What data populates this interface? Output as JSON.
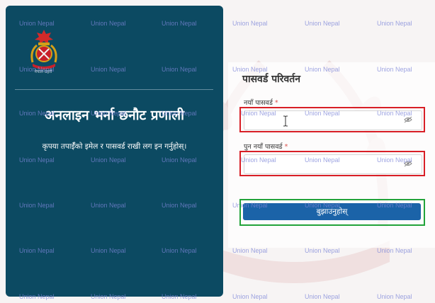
{
  "brand": {
    "logo_caption": "नेपाल प्रहरी",
    "title": "अनलाइन भर्ना छनौट प्रणाली",
    "subtitle": "कृपया तपाईँको इमेल र पासवर्ड राखी लग इन गर्नुहोस्।"
  },
  "form": {
    "heading": "पासवर्ड परिवर्तन",
    "new_password_label": "नयाँ पासवर्ड",
    "new_password_required": "*",
    "new_password_value": "",
    "confirm_password_label": "पुन नयाँ पासवर्ड",
    "confirm_password_required": "*",
    "confirm_password_value": "",
    "submit_label": "बुझाउनुहोस्"
  },
  "watermark": {
    "text": "Union Nepal"
  },
  "colors": {
    "panel": "#0c4a62",
    "button": "#1b63a8",
    "required": "#d9534f",
    "highlight_red": "#d81f26",
    "highlight_green": "#22a33a"
  },
  "icons": {
    "new_password_toggle": "eye-slash-icon",
    "confirm_password_toggle": "eye-slash-icon",
    "cursor": "text-cursor-icon",
    "logo": "police-emblem-icon"
  }
}
